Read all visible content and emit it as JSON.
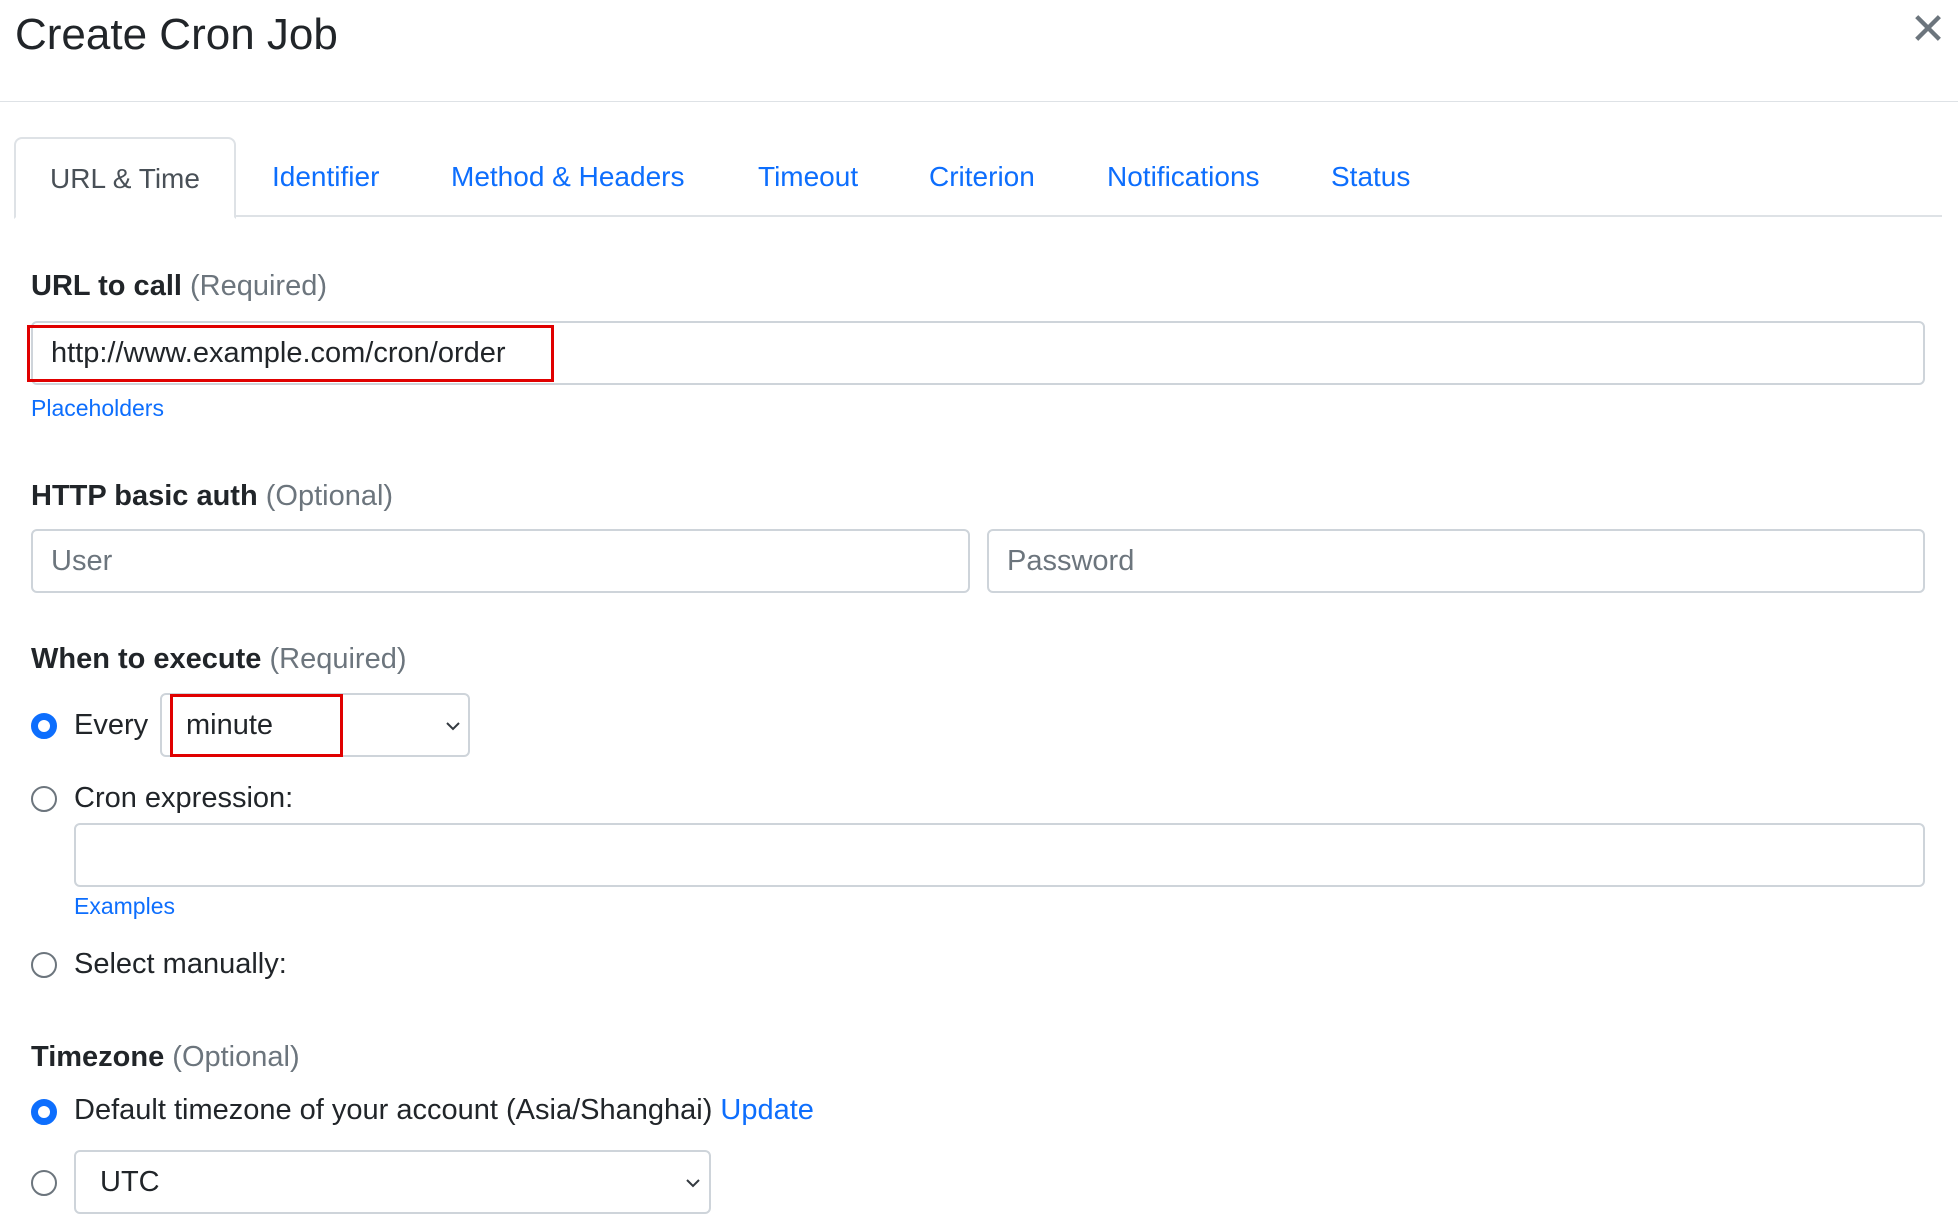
{
  "header": {
    "title": "Create Cron Job",
    "close_symbol": "✕"
  },
  "tabs": [
    {
      "label": "URL & Time",
      "active": true
    },
    {
      "label": "Identifier"
    },
    {
      "label": "Method & Headers"
    },
    {
      "label": "Timeout"
    },
    {
      "label": "Criterion"
    },
    {
      "label": "Notifications"
    },
    {
      "label": "Status"
    }
  ],
  "url": {
    "label": "URL to call",
    "hint": "(Required)",
    "value": "http://www.example.com/cron/order",
    "placeholders_link": "Placeholders"
  },
  "auth": {
    "label": "HTTP basic auth",
    "hint": "(Optional)",
    "user_placeholder": "User",
    "password_placeholder": "Password"
  },
  "execute": {
    "label": "When to execute",
    "hint": "(Required)",
    "every_label": "Every",
    "every_value": "minute",
    "cron_label": "Cron expression:",
    "cron_value": "",
    "examples_link": "Examples",
    "manual_label": "Select manually:"
  },
  "timezone": {
    "label": "Timezone",
    "hint": "(Optional)",
    "default_label": "Default timezone of your account (Asia/Shanghai)",
    "update_link": "Update",
    "select_value": "UTC"
  },
  "colors": {
    "accent": "#0d6efd",
    "highlight": "#e00000"
  }
}
